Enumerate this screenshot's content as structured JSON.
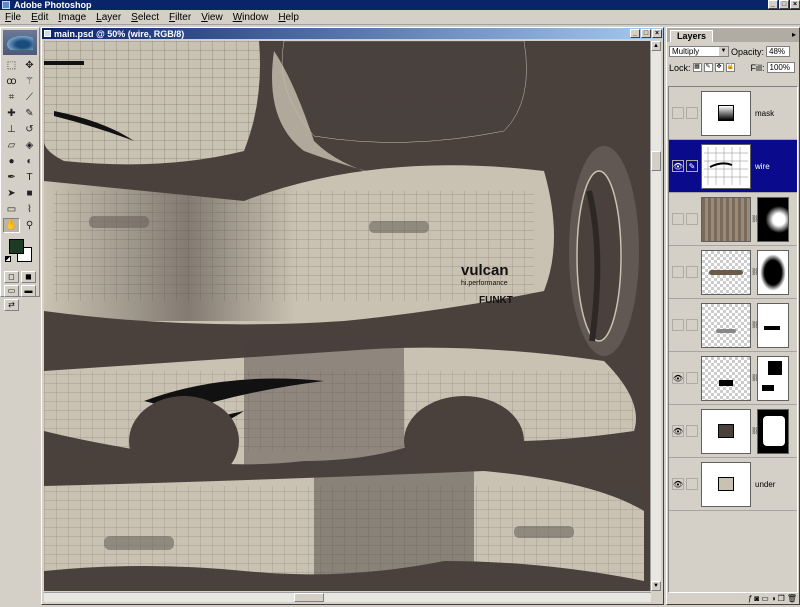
{
  "app": {
    "title": "Adobe Photoshop"
  },
  "menu": [
    "File",
    "Edit",
    "Image",
    "Layer",
    "Select",
    "Filter",
    "View",
    "Window",
    "Help"
  ],
  "document": {
    "title": "main.psd @ 50% (wire, RGB/8)",
    "artwork_text": {
      "brand": "vulcan",
      "tagline": "hi.performance",
      "sub": "FUNKT"
    }
  },
  "tools": [
    "marquee",
    "move",
    "lasso",
    "magic-wand",
    "crop",
    "slice",
    "healing",
    "brush",
    "stamp",
    "history-brush",
    "eraser",
    "bucket",
    "blur",
    "dodge",
    "pen",
    "type",
    "path-select",
    "shape",
    "notes",
    "eyedropper",
    "hand",
    "zoom"
  ],
  "colors": {
    "foreground": "#1d3a24",
    "background": "#ffffff",
    "canvas_bg": "#4a413d",
    "uv_fill": "#c9c2b2"
  },
  "layers_panel": {
    "tab": "Layers",
    "blend_mode": "Multiply",
    "opacity_label": "Opacity:",
    "opacity": "48%",
    "fill_label": "Fill:",
    "fill": "100%",
    "lock_label": "Lock:",
    "layers": [
      {
        "name": "mask",
        "visible": false,
        "selected": false,
        "has_mask": false
      },
      {
        "name": "wire",
        "visible": true,
        "selected": true,
        "has_mask": false
      },
      {
        "name": "",
        "visible": false,
        "selected": false,
        "has_mask": true
      },
      {
        "name": "",
        "visible": false,
        "selected": false,
        "has_mask": true
      },
      {
        "name": "",
        "visible": false,
        "selected": false,
        "has_mask": true
      },
      {
        "name": "",
        "visible": true,
        "selected": false,
        "has_mask": true
      },
      {
        "name": "",
        "visible": true,
        "selected": false,
        "has_mask": true
      },
      {
        "name": "under",
        "visible": true,
        "selected": false,
        "has_mask": false
      }
    ]
  }
}
